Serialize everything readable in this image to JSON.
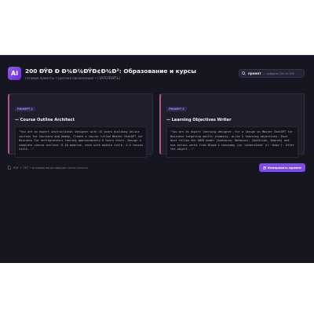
{
  "app": {
    "logo": "AI",
    "title": "200 ÐŸÐ Ð Ð¾Ð¼ÐŸÐ¢Ð¾Ð²: Образование и курсы",
    "subtitle": "готовые промпты • русская локализация • [ЗАПОЛНИТЬ]"
  },
  "search": {
    "value": "промпт",
    "count": "— найдено 200 из 200"
  },
  "cards": [
    {
      "badge": "PROMPT 1",
      "title": "— Course Outline Architect",
      "body": "\"You are an expert instructional designer with 15 years building online courses for Coursera and Udemy. Create a course titled Master ChatGPT for Business for entrepreneurs lasting approximately 6 hours hours. Design a complete course outline: 6-10 modules, each with module title, 4-5 lesson title...\""
    },
    {
      "badge": "PROMPT 2",
      "title": "— Learning Objectives Writer",
      "body": "\"You are an expert learning designer. For a lesson on Master ChatGPT for Business targeting adults students, write 5 learning objectives. Each must follow the ABCD model [Audience, Behavior, Condition, Degree] and use action verbs from Bloom's taxonomy (no 'understand' or 'know'). After the object...\""
    }
  ],
  "footer": {
    "note": "PDF + TXT • мгновенная активация после оплаты",
    "copy_label": "Копировать промпт"
  },
  "colors": {
    "accent": "#7c4fe0",
    "card_border": "#b5568a",
    "badge_text": "#a98bf0"
  }
}
